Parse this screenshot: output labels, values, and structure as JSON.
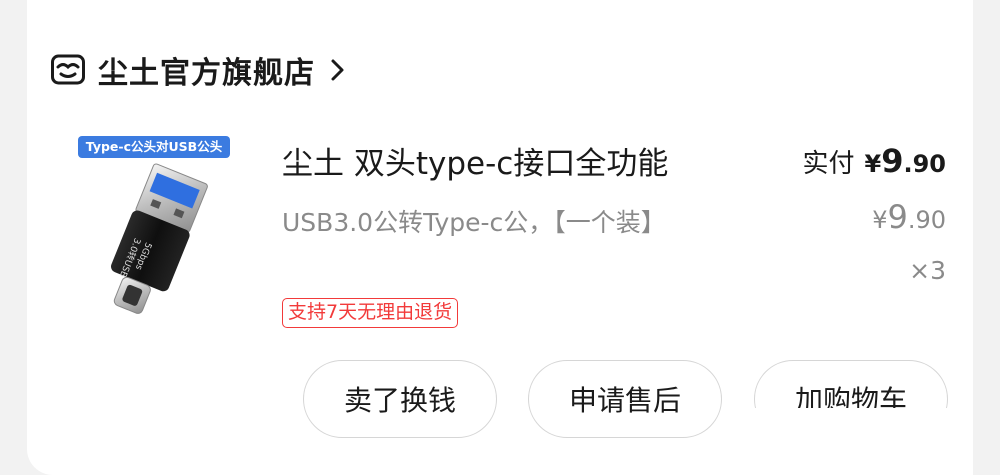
{
  "store": {
    "name": "尘土官方旗舰店",
    "icon": "store-icon",
    "chevron": "chevron-right-icon"
  },
  "product": {
    "image_tag": "Type-c公头对USB公头",
    "image_print_1": "3.0转USB",
    "image_print_2": "5Gbps",
    "title": "尘土 双头type-c接口全功能",
    "spec": "USB3.0公转Type-c公，【一个装】",
    "return_policy": "支持7天无理由退货"
  },
  "price": {
    "paid_label": "实付",
    "currency": "¥",
    "paid_int": "9",
    "paid_dec": ".90",
    "unit_int": "9",
    "unit_dec": ".90",
    "quantity": "×3"
  },
  "actions": {
    "sell": "卖了换钱",
    "after_sale": "申请售后",
    "add_cart": "加购物车"
  },
  "colors": {
    "accent_red": "#f23a3a",
    "tag_blue": "#3b7be0"
  }
}
